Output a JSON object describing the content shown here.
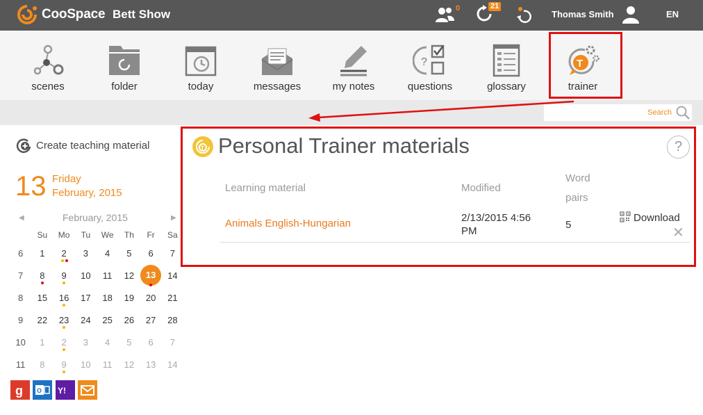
{
  "topbar": {
    "brand": "CooSpace",
    "scene": "Bett Show",
    "members_count": "0",
    "activity_count": "21",
    "user_name": "Thomas Smith",
    "language": "EN"
  },
  "modules": [
    {
      "label": "scenes"
    },
    {
      "label": "folder"
    },
    {
      "label": "today"
    },
    {
      "label": "messages"
    },
    {
      "label": "my notes"
    },
    {
      "label": "questions"
    },
    {
      "label": "glossary"
    },
    {
      "label": "trainer"
    }
  ],
  "search": {
    "placeholder": "Search"
  },
  "sidebar": {
    "create_label": "Create teaching material",
    "big_day": "13",
    "weekday": "Friday",
    "month_year": "February, 2015",
    "calendar_month": "February, 2015",
    "prev": "◀",
    "next": "▶",
    "weekdays": [
      "Su",
      "Mo",
      "Tu",
      "We",
      "Th",
      "Fr",
      "Sa"
    ],
    "weeks": [
      {
        "wk": "6",
        "days": [
          "1",
          "2",
          "3",
          "4",
          "5",
          "6",
          "7"
        ]
      },
      {
        "wk": "7",
        "days": [
          "8",
          "9",
          "10",
          "11",
          "12",
          "13",
          "14"
        ]
      },
      {
        "wk": "8",
        "days": [
          "15",
          "16",
          "17",
          "18",
          "19",
          "20",
          "21"
        ]
      },
      {
        "wk": "9",
        "days": [
          "22",
          "23",
          "24",
          "25",
          "26",
          "27",
          "28"
        ]
      },
      {
        "wk": "10",
        "days": [
          "1",
          "2",
          "3",
          "4",
          "5",
          "6",
          "7"
        ]
      },
      {
        "wk": "11",
        "days": [
          "8",
          "9",
          "10",
          "11",
          "12",
          "13",
          "14"
        ]
      }
    ]
  },
  "main": {
    "title": "Personal Trainer materials",
    "help": "?",
    "columns": {
      "material": "Learning material",
      "modified": "Modified",
      "pairs_line1": "Word",
      "pairs_line2": "pairs"
    },
    "rows": [
      {
        "material": "Animals English-Hungarian",
        "modified_line1": "2/13/2015 4:56",
        "modified_line2": "PM",
        "pairs": "5",
        "download": "Download",
        "delete": "✕"
      }
    ]
  },
  "colors": {
    "accent": "#f08a1c",
    "topbar": "#575757",
    "annotation": "#e01010"
  }
}
